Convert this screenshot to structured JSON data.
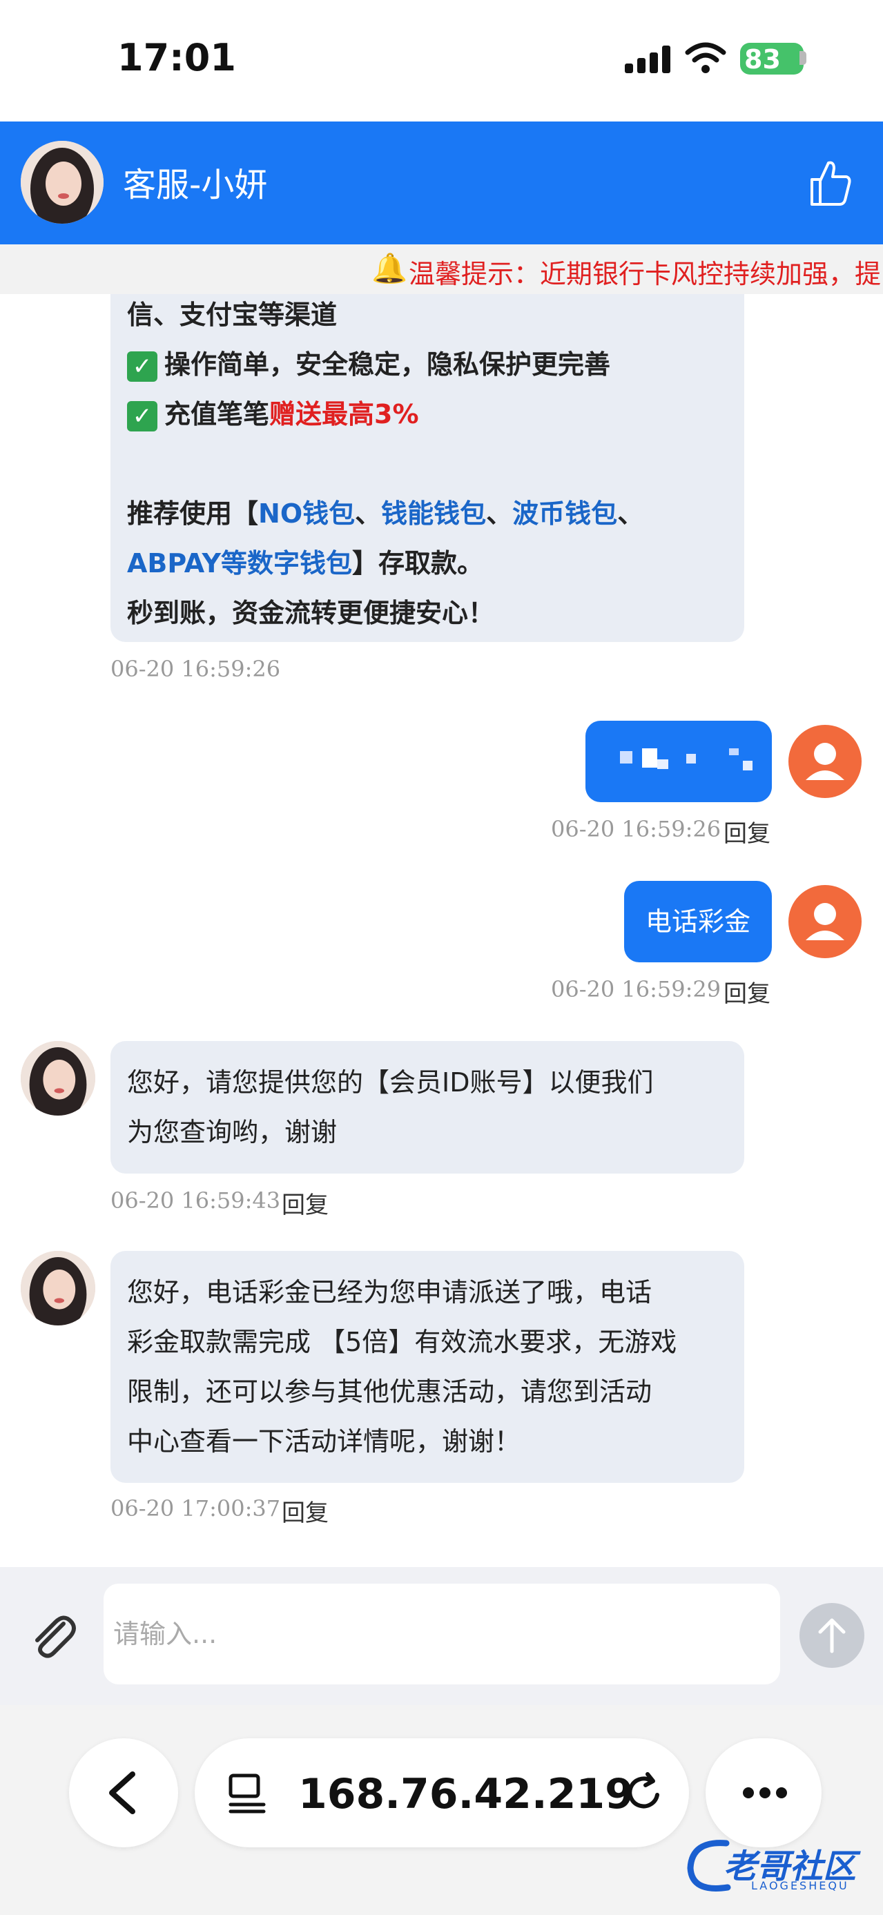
{
  "status_bar": {
    "time": "17:01",
    "battery": "83"
  },
  "header": {
    "title": "客服-小妍"
  },
  "notice": {
    "text": "温馨提示：近期银行卡风控持续加强，提"
  },
  "messages": {
    "m1": {
      "line1": "信、支付宝等渠道",
      "line2": "操作简单，安全稳定，隐私保护更完善",
      "line3a": "充值笔笔",
      "line3b": "赠送最高3%",
      "line4a": "推荐使用【",
      "line4b": "NO钱包",
      "line4c": "、",
      "line4d": "钱能钱包",
      "line4e": "、",
      "line4f": "波币钱包",
      "line4g": "、",
      "line5a": "ABPAY等数字钱包",
      "line5b": "】存取款。",
      "line6": "秒到账，资金流转更便捷安心！",
      "time": "06-20 16:59:26"
    },
    "m2": {
      "time": "06-20 16:59:26",
      "reply": "回复"
    },
    "m3": {
      "text": "电话彩金",
      "time": "06-20 16:59:29",
      "reply": "回复"
    },
    "m4": {
      "line1": "您好，请您提供您的【会员ID账号】以便我们",
      "line2": "为您查询哟，谢谢",
      "time": "06-20 16:59:43",
      "reply": "回复"
    },
    "m5": {
      "line1": "您好，电话彩金已经为您申请派送了哦，电话",
      "line2": "彩金取款需完成 【5倍】有效流水要求，无游戏",
      "line3": "限制，还可以参与其他优惠活动，请您到活动",
      "line4": "中心查看一下活动详情呢，谢谢！",
      "time": "06-20 17:00:37",
      "reply": "回复"
    }
  },
  "input": {
    "placeholder": "请输入..."
  },
  "browser": {
    "url": "168.76.42.219"
  },
  "watermark": {
    "text": "老哥社区",
    "sub": "LAOGESHEQU"
  },
  "colors": {
    "primary": "#1a78f5",
    "bubble_in": "#e9edf4",
    "avatar_out": "#f26a3c",
    "notice_red": "#e02020",
    "link_blue": "#1a66c8"
  }
}
